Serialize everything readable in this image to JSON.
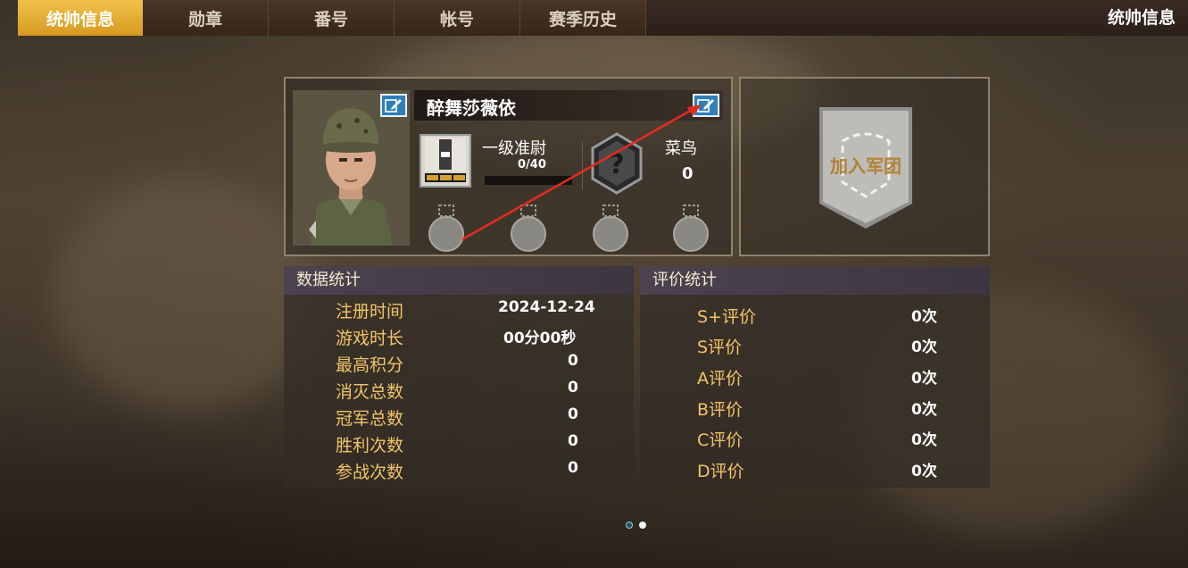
{
  "tabs": [
    {
      "label": "统帅信息",
      "active": true
    },
    {
      "label": "勋章",
      "active": false
    },
    {
      "label": "番号",
      "active": false
    },
    {
      "label": "帐号",
      "active": false
    },
    {
      "label": "赛季历史",
      "active": false
    }
  ],
  "header_title": "统帅信息",
  "profile": {
    "name": "醉舞莎薇依",
    "rank_name": "一级准尉",
    "rank_xp": "0/40",
    "rank_progress": 0,
    "title_name": "菜鸟",
    "title_value": "0",
    "unknown_badge_symbol": "?"
  },
  "legion": {
    "button_label": "加入军团"
  },
  "data_stats": {
    "title": "数据统计",
    "rows": [
      {
        "label": "注册时间",
        "value": "2024-12-24"
      },
      {
        "label": "游戏时长",
        "value": "00分00秒"
      },
      {
        "label": "最高积分",
        "value": "0"
      },
      {
        "label": "消灭总数",
        "value": "0"
      },
      {
        "label": "冠军总数",
        "value": "0"
      },
      {
        "label": "胜利次数",
        "value": "0"
      },
      {
        "label": "参战次数",
        "value": "0"
      }
    ]
  },
  "rating_stats": {
    "title": "评价统计",
    "rows": [
      {
        "label": "S+评价",
        "value": "0次"
      },
      {
        "label": "S评价",
        "value": "0次"
      },
      {
        "label": "A评价",
        "value": "0次"
      },
      {
        "label": "B评价",
        "value": "0次"
      },
      {
        "label": "C评价",
        "value": "0次"
      },
      {
        "label": "D评价",
        "value": "0次"
      }
    ]
  },
  "pagination": {
    "pages": 2,
    "current": 2
  },
  "colors": {
    "accent": "#e8b035",
    "label_gold": "#f1c36a",
    "edit_blue": "#2f7fb9"
  }
}
